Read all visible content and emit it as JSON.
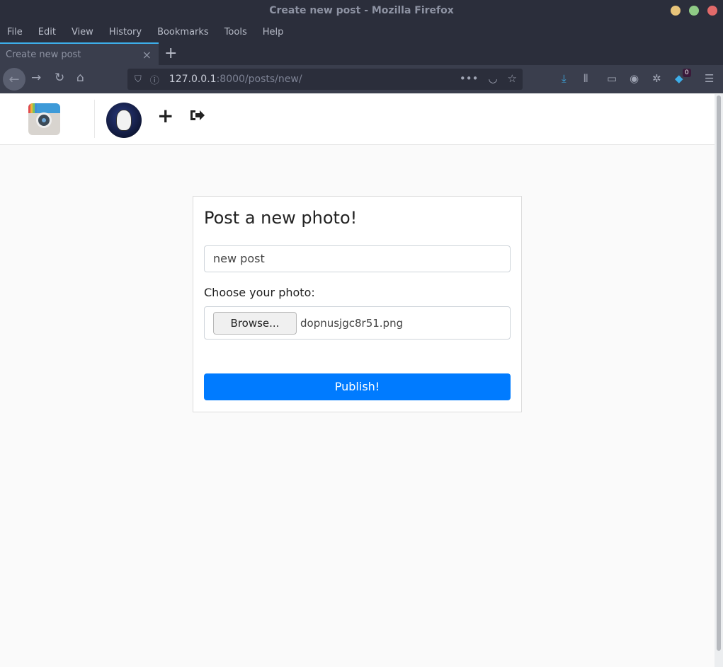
{
  "window": {
    "title": "Create new post - Mozilla Firefox"
  },
  "menu": {
    "file": "File",
    "edit": "Edit",
    "view": "View",
    "history": "History",
    "bookmarks": "Bookmarks",
    "tools": "Tools",
    "help": "Help"
  },
  "tab": {
    "label": "Create new post",
    "close": "×",
    "new": "+"
  },
  "url": {
    "host": "127.0.0.1",
    "rest": ":8000/posts/new/",
    "dots": "•••"
  },
  "toolbar": {
    "badge_count": "0"
  },
  "form": {
    "title": "Post a new photo!",
    "caption_value": "new post",
    "choose_label": "Choose your photo:",
    "browse_label": "Browse...",
    "file_name": "dopnusjgc8r51.png",
    "publish_label": "Publish!"
  },
  "colors": {
    "accent": "#007bff",
    "tab_highlight": "#3daee9"
  }
}
